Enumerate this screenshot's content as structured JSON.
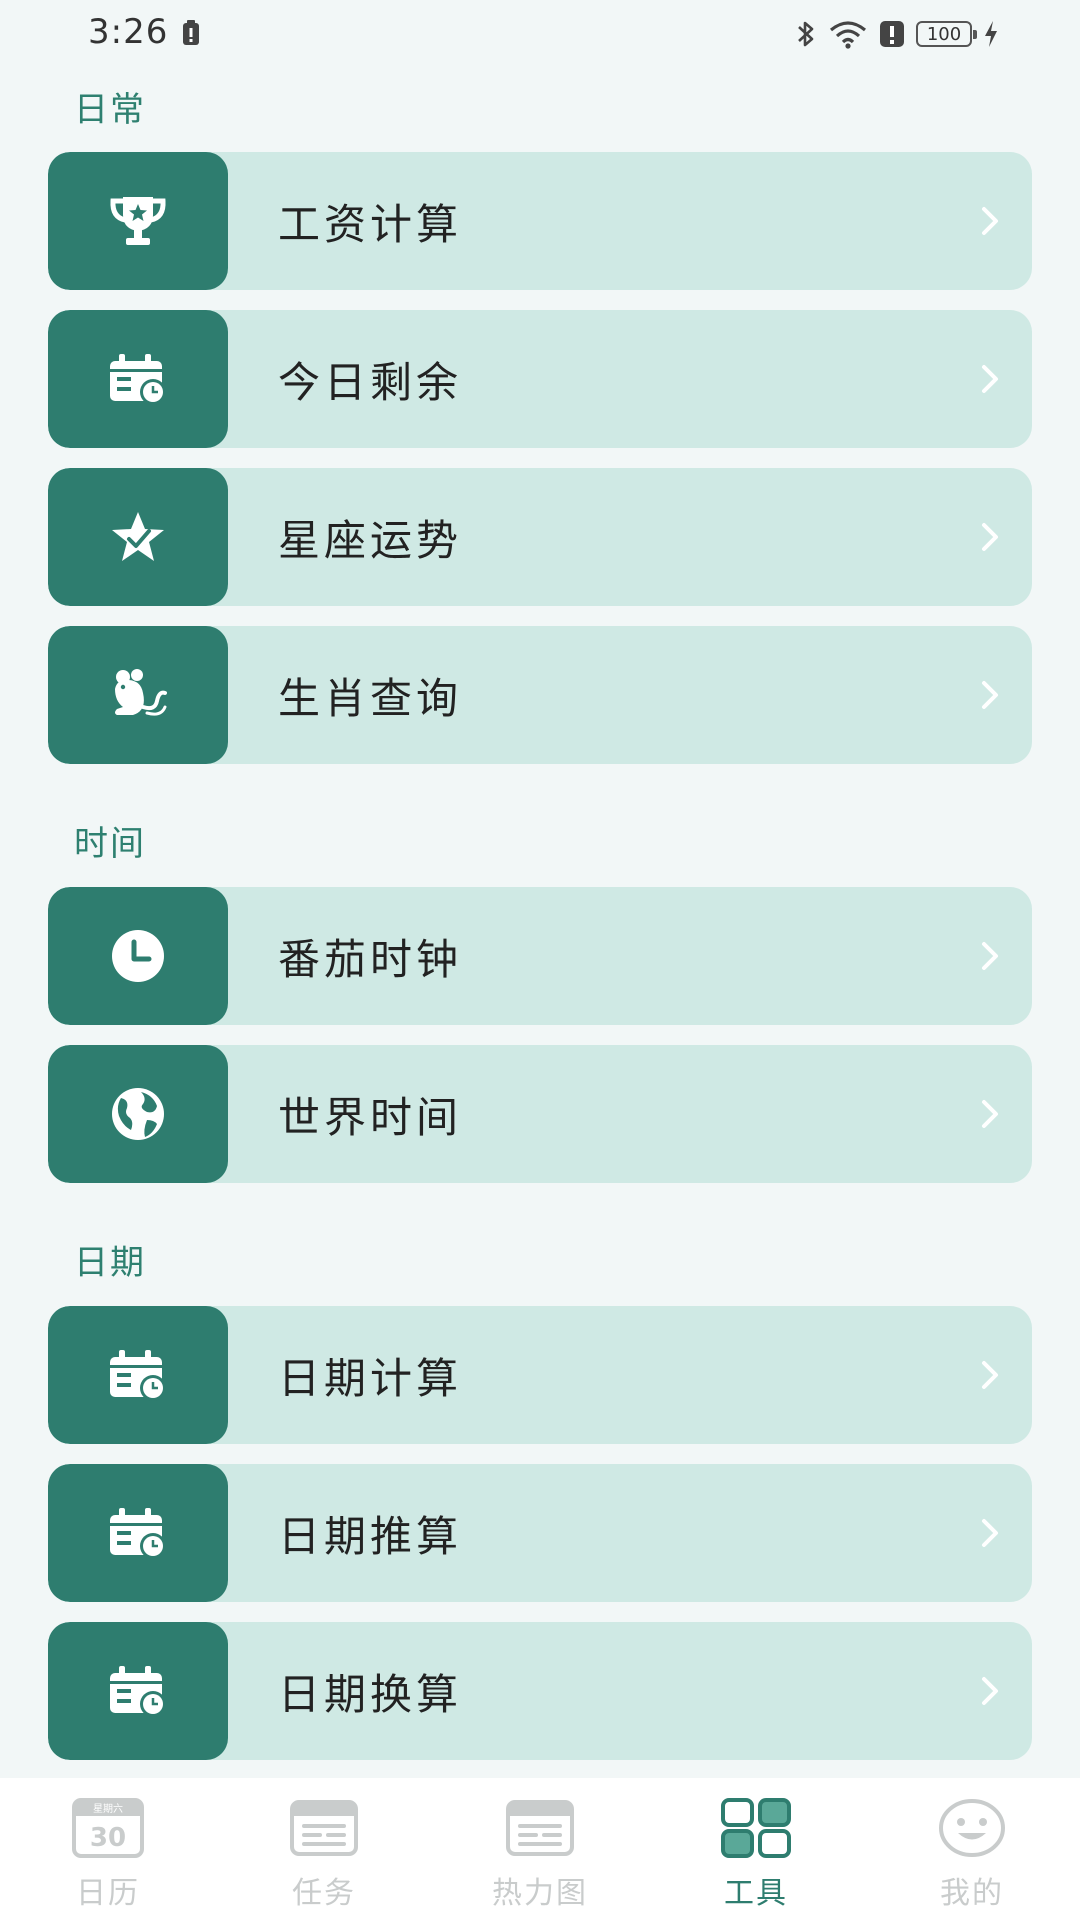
{
  "status_bar": {
    "time": "3:26",
    "battery": "100"
  },
  "sections": [
    {
      "title": "日常",
      "items": [
        {
          "label": "工资计算",
          "icon": "trophy-icon"
        },
        {
          "label": "今日剩余",
          "icon": "calendar-clock-icon"
        },
        {
          "label": "星座运势",
          "icon": "star-icon"
        },
        {
          "label": "生肖查询",
          "icon": "rat-icon"
        }
      ]
    },
    {
      "title": "时间",
      "items": [
        {
          "label": "番茄时钟",
          "icon": "clock-icon"
        },
        {
          "label": "世界时间",
          "icon": "globe-icon"
        }
      ]
    },
    {
      "title": "日期",
      "items": [
        {
          "label": "日期计算",
          "icon": "calendar-clock-icon"
        },
        {
          "label": "日期推算",
          "icon": "calendar-clock-icon"
        },
        {
          "label": "日期换算",
          "icon": "calendar-clock-icon"
        }
      ]
    }
  ],
  "bottom_nav": {
    "calendar_date": "30",
    "calendar_weekday": "星期六",
    "items": [
      {
        "label": "日历",
        "icon": "calendar-day-icon",
        "active": false
      },
      {
        "label": "任务",
        "icon": "task-card-icon",
        "active": false
      },
      {
        "label": "热力图",
        "icon": "heatmap-card-icon",
        "active": false
      },
      {
        "label": "工具",
        "icon": "grid-icon",
        "active": true
      },
      {
        "label": "我的",
        "icon": "smiley-icon",
        "active": false
      }
    ]
  },
  "colors": {
    "accent": "#2e7d6f",
    "row_bg": "#cfe9e4",
    "page_bg": "#f2f7f7",
    "nav_inactive": "#c9cccc"
  }
}
